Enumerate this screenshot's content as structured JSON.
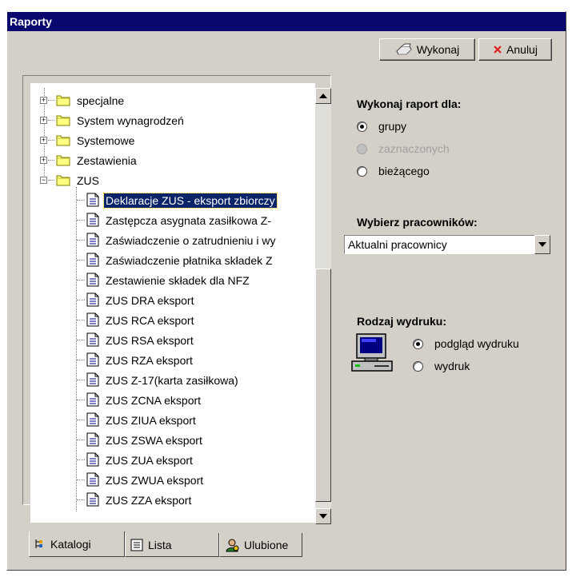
{
  "window": {
    "title": "Raporty"
  },
  "toolbar": {
    "execute_label": "Wykonaj",
    "cancel_label": "Anuluj"
  },
  "tree": {
    "folders": [
      {
        "label": "specjalne",
        "expanded": false
      },
      {
        "label": "System wynagrodzeń",
        "expanded": false
      },
      {
        "label": "Systemowe",
        "expanded": false
      },
      {
        "label": "Zestawienia",
        "expanded": false
      },
      {
        "label": "ZUS",
        "expanded": true
      }
    ],
    "items": [
      {
        "label": "Deklaracje ZUS - eksport zbiorczy",
        "selected": true
      },
      {
        "label": "Zastępcza asygnata zasiłkowa Z-"
      },
      {
        "label": "Zaświadczenie o zatrudnieniu i wy"
      },
      {
        "label": "Zaświadczenie płatnika składek Z"
      },
      {
        "label": "Zestawienie składek dla NFZ"
      },
      {
        "label": "ZUS DRA eksport"
      },
      {
        "label": "ZUS RCA eksport"
      },
      {
        "label": "ZUS RSA eksport"
      },
      {
        "label": "ZUS RZA eksport"
      },
      {
        "label": "ZUS Z-17(karta zasiłkowa)"
      },
      {
        "label": "ZUS ZCNA eksport"
      },
      {
        "label": "ZUS ZIUA eksport"
      },
      {
        "label": "ZUS ZSWA eksport"
      },
      {
        "label": "ZUS ZUA eksport"
      },
      {
        "label": "ZUS ZWUA eksport"
      },
      {
        "label": "ZUS ZZA eksport"
      }
    ]
  },
  "tabs": [
    {
      "label": "Katalogi",
      "active": true
    },
    {
      "label": "Lista",
      "active": false
    },
    {
      "label": "Ulubione",
      "active": false
    }
  ],
  "report_for": {
    "title": "Wykonaj raport dla:",
    "options": [
      {
        "label": "grupy",
        "checked": true,
        "disabled": false
      },
      {
        "label": "zaznaczonych",
        "checked": false,
        "disabled": true
      },
      {
        "label": "bieżącego",
        "checked": false,
        "disabled": false
      }
    ]
  },
  "employees": {
    "title": "Wybierz pracowników:",
    "selected": "Aktualni pracownicy"
  },
  "print_type": {
    "title": "Rodzaj wydruku:",
    "options": [
      {
        "label": "podgląd wydruku",
        "checked": true
      },
      {
        "label": "wydruk",
        "checked": false
      }
    ]
  },
  "colors": {
    "titlebar": "#08086e",
    "selection": "#0a246a",
    "folder": "#ffff80",
    "cancel_x": "#e02020"
  },
  "icons": {
    "execute": "printer-icon",
    "cancel": "x-icon",
    "folder": "folder-icon",
    "document": "document-icon",
    "katalogi": "tree-icon",
    "lista": "list-icon",
    "ulubione": "person-icon",
    "preview": "computer-icon"
  }
}
